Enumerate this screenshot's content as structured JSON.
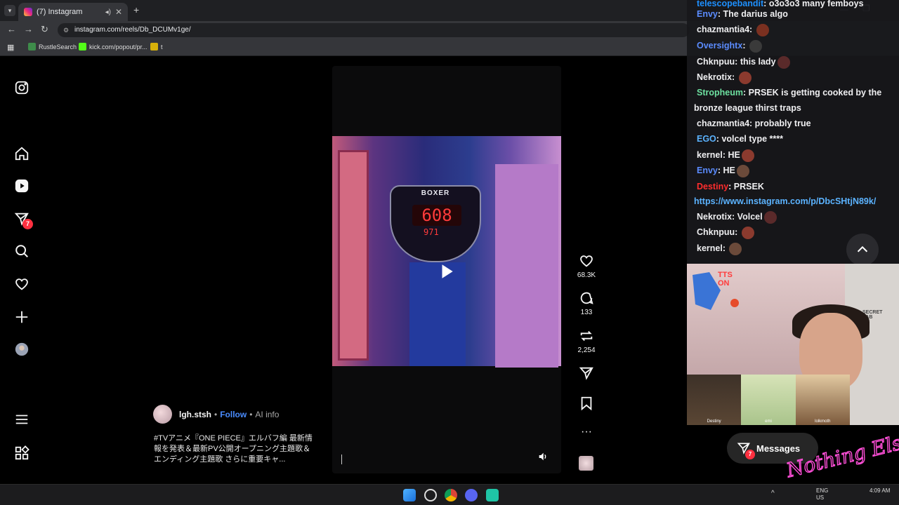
{
  "browser": {
    "tab_title": "(7) Instagram",
    "url": "instagram.com/reels/Db_DCUMv1ge/",
    "bookmarks": [
      "RustleSearch",
      "kick.com/popout/pr...",
      "t"
    ]
  },
  "sidebar": {
    "notification_count": "7"
  },
  "reel": {
    "machine_label": "BOXER",
    "score_main": "608",
    "score_sub": "971",
    "username": "lgh.stsh",
    "follow_label": "Follow",
    "ai_info_label": "AI info",
    "separator": "•",
    "caption": "#TVアニメ『ONE PIECE』エルバフ編 最新情報を発表＆最新PV公開オープニング主題歌＆エンディング主題歌 さらに重要キャ...",
    "likes": "68.3K",
    "comments": "133",
    "reposts": "2,254"
  },
  "chat": {
    "messages": [
      {
        "user": "telescopebandit",
        "text": "o3o3o3 many femboys",
        "color": "#1e90ff"
      },
      {
        "user": "Envy",
        "text": "The darius algo",
        "color": "#5b8cff"
      },
      {
        "user": "chazmantia4",
        "text": "",
        "color": "#efeff1"
      },
      {
        "user": "Oversightx",
        "text": "",
        "color": "#5b8cff"
      },
      {
        "user": "Chknpuu",
        "text": "this lady",
        "color": "#efeff1"
      },
      {
        "user": "Nekrotix",
        "text": "",
        "color": "#efeff1"
      },
      {
        "user": "Stropheum",
        "text": "PRSEK is getting cooked by the",
        "color": "#6de0a0"
      },
      {
        "user": "",
        "text": "bronze league thirst traps",
        "color": "#efeff1"
      },
      {
        "user": "chazmantia4",
        "text": "probably true",
        "color": "#efeff1"
      },
      {
        "user": "EGO",
        "text": "volcel type ****",
        "color": "#5bb3ff"
      },
      {
        "user": "kernel",
        "text": "HE",
        "color": "#efeff1"
      },
      {
        "user": "Envy",
        "text": "HE",
        "color": "#5b8cff"
      },
      {
        "user": "Destiny",
        "text": "PRSEK",
        "color": "#ff2d2d"
      },
      {
        "user": "",
        "text": "https://www.instagram.com/p/DbcSHtjN89k/",
        "color": "#5bb3ff"
      },
      {
        "user": "Nekrotix",
        "text": "Volcel",
        "color": "#efeff1"
      },
      {
        "user": "Chknpuu",
        "text": "",
        "color": "#efeff1"
      },
      {
        "user": "kernel",
        "text": "",
        "color": "#efeff1"
      }
    ]
  },
  "cam": {
    "overlay_text": "TTS ON",
    "brand": "SECRET LAB",
    "thumbs": [
      "Destiny",
      "emi",
      "lolkmoth"
    ]
  },
  "messages_button": {
    "label": "Messages",
    "badge": "7"
  },
  "watermark": "Nothing Else?",
  "taskbar": {
    "lang": "ENG",
    "region": "US",
    "time": "4:09 AM"
  },
  "colors": {
    "accent_blue": "#4a8cff",
    "badge_red": "#ff3040"
  }
}
